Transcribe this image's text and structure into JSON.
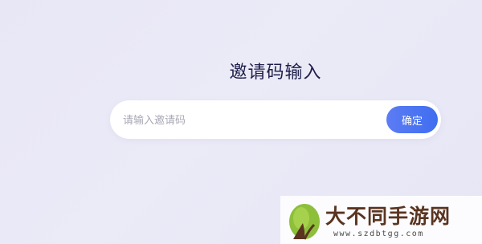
{
  "invite": {
    "title": "邀请码输入",
    "input_placeholder": "请输入邀请码",
    "input_value": "",
    "confirm_label": "确定"
  },
  "watermark": {
    "name": "大不同手游网",
    "url": "www.szdbtgg.com"
  },
  "colors": {
    "background": "#e9e8f6",
    "title": "#1e1e4a",
    "button_start": "#5c7cf4",
    "button_end": "#3f6ef0",
    "watermark_text": "#5a3420"
  }
}
